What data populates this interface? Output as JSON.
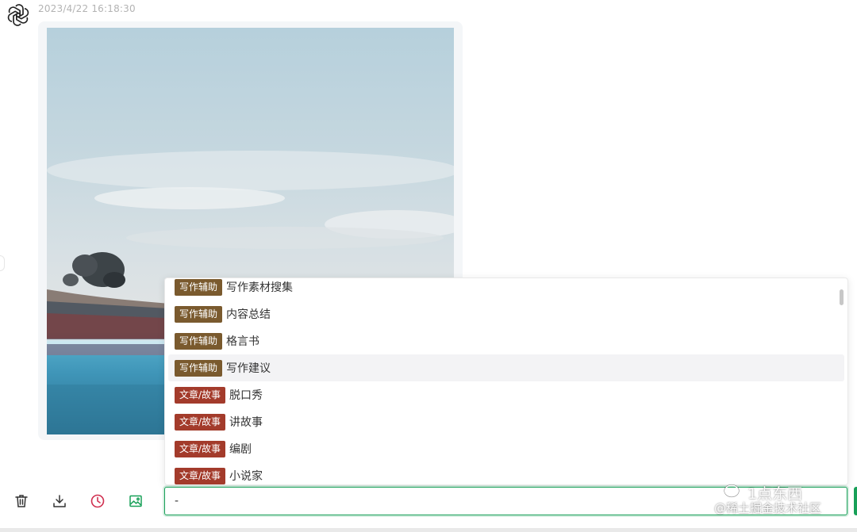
{
  "message": {
    "timestamp": "2023/4/22 16:18:30",
    "avatar_icon": "openai-logo-icon"
  },
  "dropdown": {
    "items": [
      {
        "tag": "写作辅助",
        "tag_color": "#7a5a2e",
        "label": "写作素材搜集"
      },
      {
        "tag": "写作辅助",
        "tag_color": "#7a5a2e",
        "label": "内容总结"
      },
      {
        "tag": "写作辅助",
        "tag_color": "#7a5a2e",
        "label": "格言书"
      },
      {
        "tag": "写作辅助",
        "tag_color": "#7a5a2e",
        "label": "写作建议",
        "highlighted": true
      },
      {
        "tag": "文章/故事",
        "tag_color": "#a33b2b",
        "label": "脱口秀"
      },
      {
        "tag": "文章/故事",
        "tag_color": "#a33b2b",
        "label": "讲故事"
      },
      {
        "tag": "文章/故事",
        "tag_color": "#a33b2b",
        "label": "编剧"
      },
      {
        "tag": "文章/故事",
        "tag_color": "#a33b2b",
        "label": "小说家"
      }
    ]
  },
  "toolbar": {
    "delete_icon": "trash-icon",
    "download_icon": "download-icon",
    "history_icon": "history-clock-icon",
    "image_icon": "image-icon",
    "history_color": "#d03050",
    "image_color": "#18a058"
  },
  "input": {
    "value": "-"
  },
  "watermark": {
    "line1": "1点东西",
    "line2": "@稀土掘金技术社区"
  },
  "colors": {
    "accent": "#18a058"
  }
}
